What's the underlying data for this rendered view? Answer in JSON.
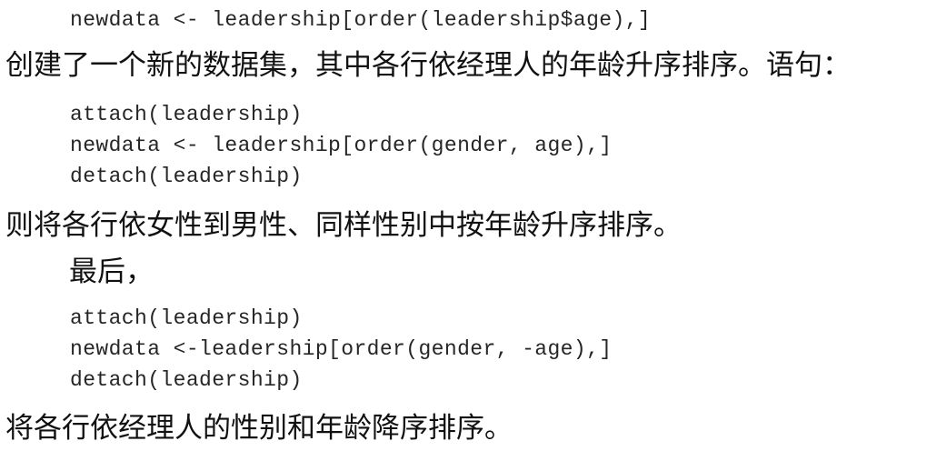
{
  "code_top": "newdata <- leadership[order(leadership$age),]",
  "para1": "创建了一个新的数据集，其中各行依经理人的年龄升序排序。语句：",
  "code_block1": [
    "attach(leadership)",
    "newdata <- leadership[order(gender, age),]",
    "detach(leadership)"
  ],
  "para2": "则将各行依女性到男性、同样性别中按年龄升序排序。",
  "para3": "最后，",
  "code_block2": [
    "attach(leadership)",
    "newdata <-leadership[order(gender, -age),]",
    "detach(leadership)"
  ],
  "para4": "将各行依经理人的性别和年龄降序排序。"
}
